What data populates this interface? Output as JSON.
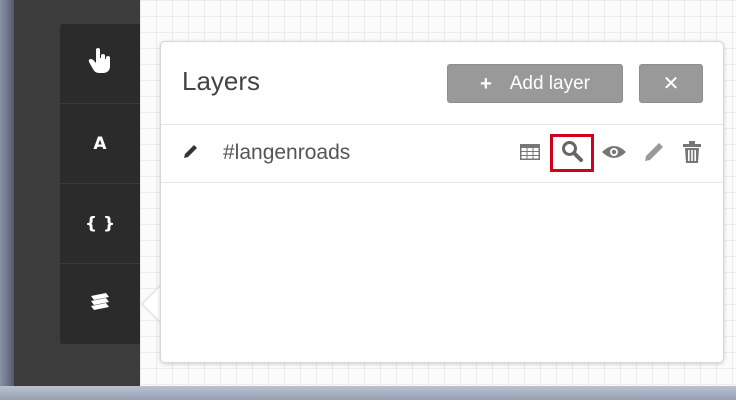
{
  "tools": [
    {
      "name": "tool-pan",
      "icon": "hand-pointer-icon"
    },
    {
      "name": "tool-text",
      "icon": "letter-a-icon",
      "glyph": "A"
    },
    {
      "name": "tool-code",
      "icon": "curly-braces-icon",
      "glyph": "{ }"
    },
    {
      "name": "tool-layers",
      "icon": "layers-icon"
    }
  ],
  "panel": {
    "title": "Layers",
    "add_button_icon": "+",
    "add_button_label": "Add layer",
    "close_button_label": "✕"
  },
  "layers": [
    {
      "name": "#langenroads",
      "highlighted_action": "zoom-to-layer"
    }
  ],
  "colors": {
    "toolstrip": "#2b2b2b",
    "button_bg": "#999999",
    "highlight": "#d0021b",
    "text": "#444444"
  }
}
